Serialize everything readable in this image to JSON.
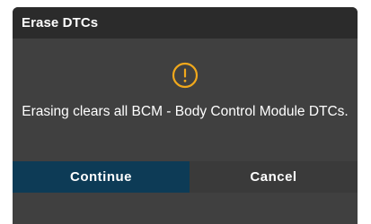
{
  "dialog": {
    "title": "Erase DTCs",
    "icon": "warning-circle-icon",
    "message": "Erasing clears all BCM - Body Control Module DTCs."
  },
  "buttons": {
    "continue_label": "Continue",
    "cancel_label": "Cancel"
  },
  "colors": {
    "accent_warning": "#f0a81c",
    "primary_button": "#0d3b56",
    "dialog_background": "#404040",
    "title_bar": "#2b2b2b"
  }
}
